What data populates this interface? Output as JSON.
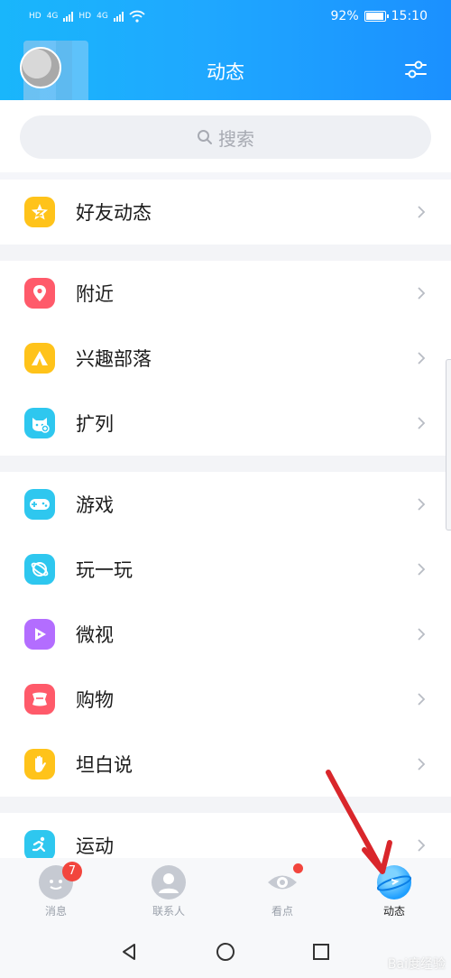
{
  "status_bar": {
    "carrier_left": [
      "HD",
      "4G",
      "HD",
      "4G"
    ],
    "battery": "92%",
    "time": "15:10"
  },
  "header": {
    "title": "动态",
    "right_icon": "filter-settings-icon"
  },
  "search": {
    "placeholder": "搜索"
  },
  "groups": [
    {
      "items": [
        {
          "label": "好友动态",
          "icon": "friends-feed-icon",
          "color": "#ffc31a"
        }
      ]
    },
    {
      "items": [
        {
          "label": "附近",
          "icon": "location-pin-icon",
          "color": "#ff5a6a"
        },
        {
          "label": "兴趣部落",
          "icon": "tent-icon",
          "color": "#ffc31a"
        },
        {
          "label": "扩列",
          "icon": "cat-plus-icon",
          "color": "#2ec7ef"
        }
      ]
    },
    {
      "items": [
        {
          "label": "游戏",
          "icon": "gamepad-icon",
          "color": "#2ec7ef"
        },
        {
          "label": "玩一玩",
          "icon": "planet-icon",
          "color": "#2ec7ef"
        },
        {
          "label": "微视",
          "icon": "play-icon",
          "color": "#b36dff"
        },
        {
          "label": "购物",
          "icon": "shopping-icon",
          "color": "#ff5a6a"
        },
        {
          "label": "坦白说",
          "icon": "hand-icon",
          "color": "#ffc31a"
        }
      ]
    },
    {
      "items": [
        {
          "label": "运动",
          "icon": "running-icon",
          "color": "#2ec7ef"
        }
      ]
    }
  ],
  "tabbar": {
    "tabs": [
      {
        "label": "消息",
        "icon": "messages-icon",
        "badge": "7"
      },
      {
        "label": "联系人",
        "icon": "contacts-icon"
      },
      {
        "label": "看点",
        "icon": "eye-icon"
      },
      {
        "label": "动态",
        "icon": "planet-dynamic-icon",
        "active": true
      }
    ]
  },
  "system_nav": [
    "back",
    "home",
    "recents"
  ],
  "watermark": "Bai度经验"
}
